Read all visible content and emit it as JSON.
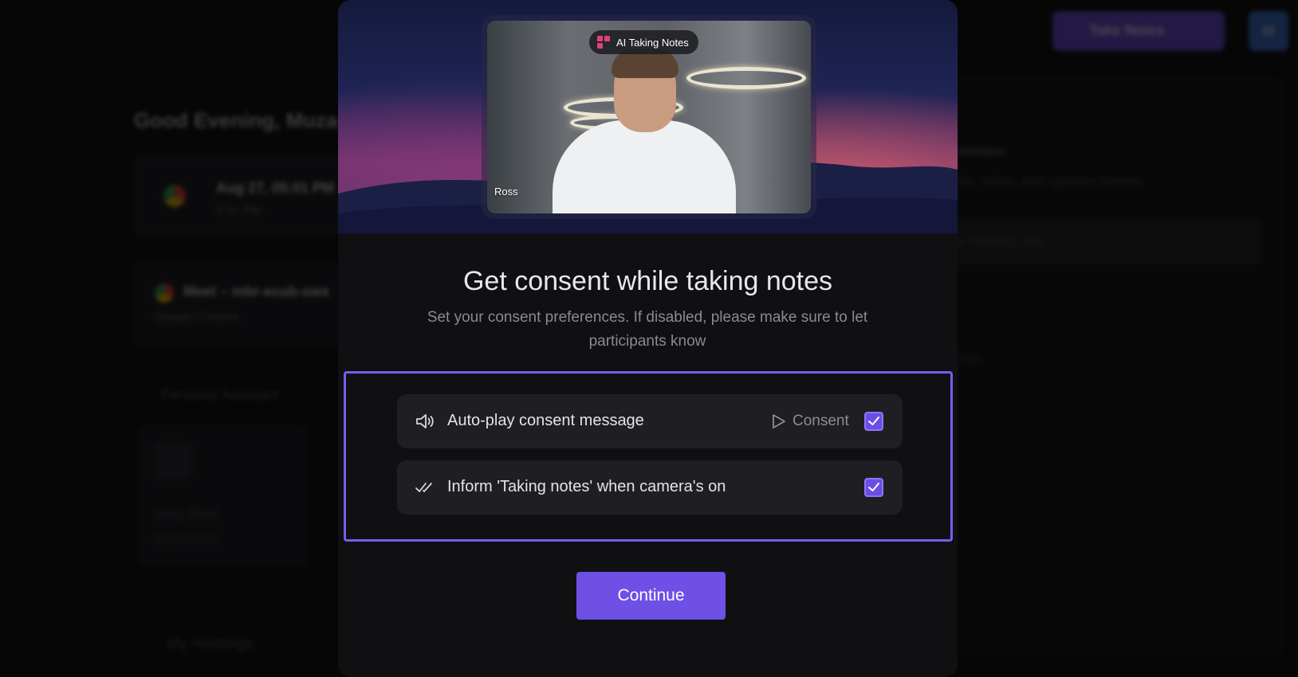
{
  "background": {
    "greeting": "Good Evening, Muza",
    "meeting_card": {
      "title": "Aug 27, 05:01 PM",
      "subtitle": "5:01 PM"
    },
    "meet_card": {
      "title": "Meet – mbr-ecub-swx",
      "subtitle": "Google Chrome"
    },
    "personal_assistant_label": "Personal Assistant",
    "daily_brief_card": {
      "title": "Daily Brief",
      "subtitle": "Not enabled"
    },
    "my_meetings_label": "My meetings",
    "take_notes_button": "Take Notes",
    "avatar_initial": "M",
    "right_panel": {
      "heading": "otetaker",
      "description": "dio, video, and speaker names",
      "input_placeholder": "e meeting URL",
      "row_text": "ings"
    }
  },
  "modal": {
    "preview": {
      "badge_label": "AI Taking Notes",
      "participant_name": "Ross"
    },
    "title": "Get consent while taking notes",
    "subtitle": "Set your consent preferences. If disabled, please make sure to let participants know",
    "options": [
      {
        "label": "Auto-play consent message",
        "icon": "speaker-icon",
        "action_label": "Consent",
        "checked": true
      },
      {
        "label": "Inform 'Taking notes' when camera's on",
        "icon": "double-check-icon",
        "checked": true
      }
    ],
    "continue_label": "Continue"
  },
  "colors": {
    "accent": "#6e50e6",
    "highlight_border": "#7a5cf0",
    "modal_bg": "#101012",
    "row_bg": "#1f1f23"
  }
}
